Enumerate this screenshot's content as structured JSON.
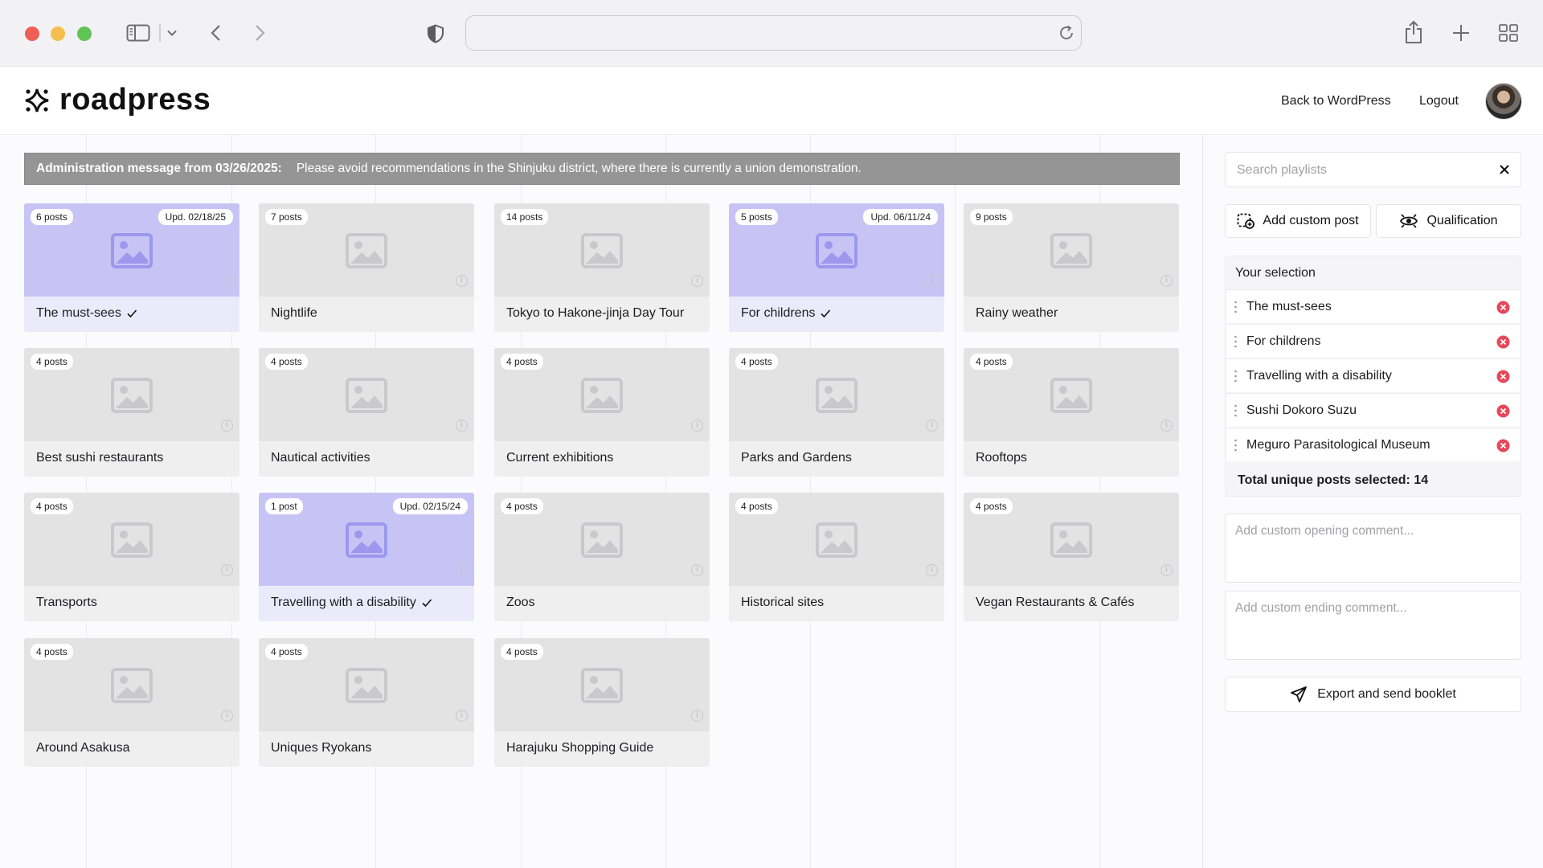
{
  "browser": {
    "url": "",
    "icons": [
      "sidebar-icon",
      "chevron-down-icon",
      "back-arrow-icon",
      "forward-arrow-icon",
      "shield-icon",
      "reload-icon",
      "share-icon",
      "new-tab-icon",
      "tab-overview-icon"
    ]
  },
  "header": {
    "logo_text": "roadpress",
    "back_link": "Back to WordPress",
    "logout_link": "Logout"
  },
  "admin_message": {
    "lead": "Administration message from 03/26/2025:",
    "text": "Please avoid recommendations in the Shinjuku district, where there is currently a union demonstration."
  },
  "playlists": [
    {
      "count": "6 posts",
      "updated": "Upd. 02/18/25",
      "title": "The must-sees",
      "selected": true
    },
    {
      "count": "7 posts",
      "updated": "",
      "title": "Nightlife",
      "selected": false
    },
    {
      "count": "14 posts",
      "updated": "",
      "title": "Tokyo to Hakone-jinja Day Tour",
      "selected": false
    },
    {
      "count": "5 posts",
      "updated": "Upd. 06/11/24",
      "title": "For childrens",
      "selected": true
    },
    {
      "count": "9 posts",
      "updated": "",
      "title": "Rainy weather",
      "selected": false
    },
    {
      "count": "4 posts",
      "updated": "",
      "title": "Best sushi restaurants",
      "selected": false
    },
    {
      "count": "4 posts",
      "updated": "",
      "title": "Nautical activities",
      "selected": false
    },
    {
      "count": "4 posts",
      "updated": "",
      "title": "Current exhibitions",
      "selected": false
    },
    {
      "count": "4 posts",
      "updated": "",
      "title": "Parks and Gardens",
      "selected": false
    },
    {
      "count": "4 posts",
      "updated": "",
      "title": "Rooftops",
      "selected": false
    },
    {
      "count": "4 posts",
      "updated": "",
      "title": "Transports",
      "selected": false
    },
    {
      "count": "1 post",
      "updated": "Upd. 02/15/24",
      "title": "Travelling with a disability",
      "selected": true
    },
    {
      "count": "4 posts",
      "updated": "",
      "title": "Zoos",
      "selected": false
    },
    {
      "count": "4 posts",
      "updated": "",
      "title": "Historical sites",
      "selected": false
    },
    {
      "count": "4 posts",
      "updated": "",
      "title": "Vegan Restaurants & Cafés",
      "selected": false
    },
    {
      "count": "4 posts",
      "updated": "",
      "title": "Around Asakusa",
      "selected": false
    },
    {
      "count": "4 posts",
      "updated": "",
      "title": "Uniques Ryokans",
      "selected": false
    },
    {
      "count": "4 posts",
      "updated": "",
      "title": "Harajuku Shopping Guide",
      "selected": false
    }
  ],
  "sidebar": {
    "search_placeholder": "Search playlists",
    "add_custom_post": "Add custom post",
    "qualification": "Qualification",
    "selection_title": "Your selection",
    "selection_items": [
      "The must-sees",
      "For childrens",
      "Travelling with a disability",
      "Sushi Dokoro Suzu",
      "Meguro Parasitological Museum"
    ],
    "total": "Total unique posts selected: 14",
    "opening_placeholder": "Add custom opening comment...",
    "ending_placeholder": "Add custom ending comment...",
    "export_label": "Export and send booklet"
  },
  "colors": {
    "selected_card": "#c7c4f5",
    "admin_banner": "#959596",
    "remove_icon": "#e8475a"
  }
}
